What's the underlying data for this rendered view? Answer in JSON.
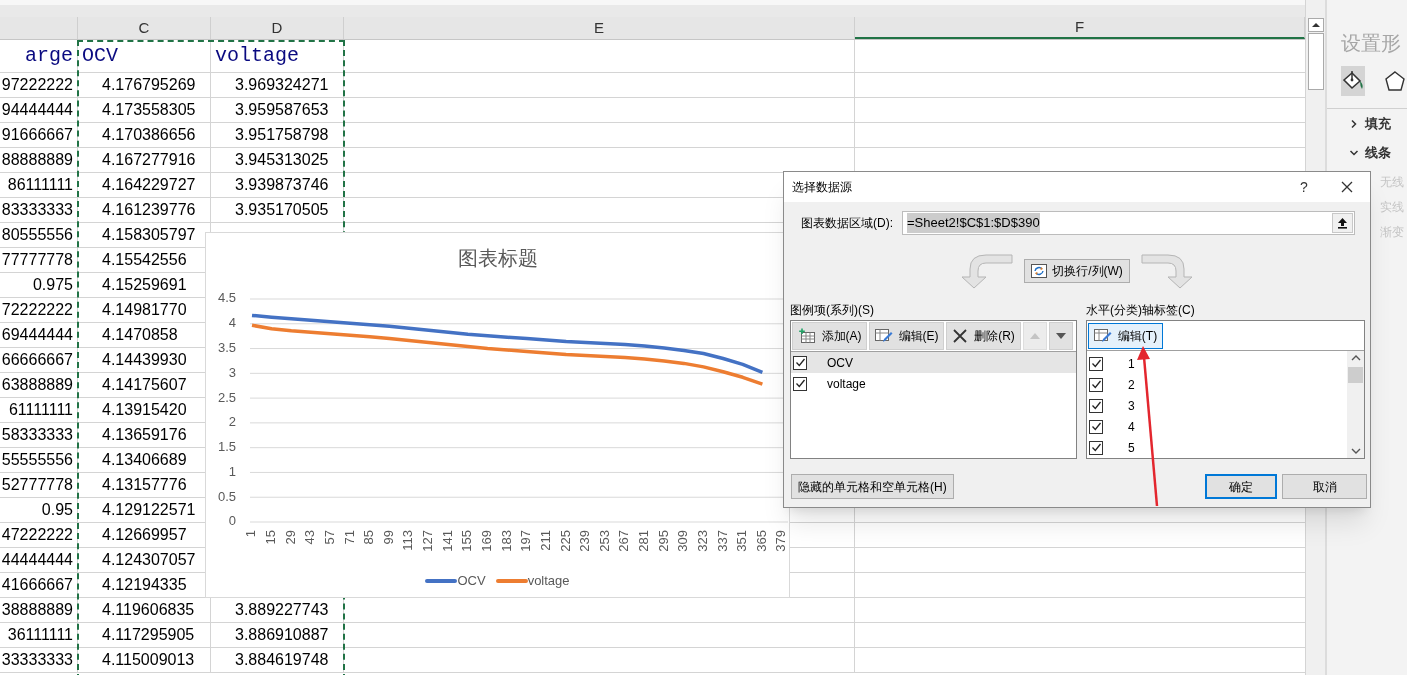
{
  "sheet": {
    "columns": [
      {
        "highlighted": false
      },
      {
        "label": "C",
        "highlighted": false
      },
      {
        "label": "D",
        "highlighted": false
      },
      {
        "label": "E",
        "highlighted": false
      },
      {
        "label": "F",
        "highlighted": true
      }
    ],
    "header_row": [
      "arge",
      "OCV",
      "voltage"
    ],
    "rows": [
      [
        "97222222",
        "4.176795269",
        "3.969324271"
      ],
      [
        "94444444",
        "4.173558305",
        "3.959587653"
      ],
      [
        "91666667",
        "4.170386656",
        "3.951758798"
      ],
      [
        "88888889",
        "4.167277916",
        "3.945313025"
      ],
      [
        "86111111",
        "4.164229727",
        "3.939873746"
      ],
      [
        "83333333",
        "4.161239776",
        "3.935170505"
      ],
      [
        "80555556",
        "4.158305797"
      ],
      [
        "77777778",
        "4.15542556"
      ],
      [
        "0.975",
        "4.15259691"
      ],
      [
        "72222222",
        "4.14981770"
      ],
      [
        "69444444",
        "4.1470858"
      ],
      [
        "66666667",
        "4.14439930"
      ],
      [
        "63888889",
        "4.14175607"
      ],
      [
        "61111111",
        "4.13915420"
      ],
      [
        "58333333",
        "4.13659176"
      ],
      [
        "55555556",
        "4.13406689"
      ],
      [
        "52777778",
        "4.13157776"
      ],
      [
        "0.95",
        "4.129122571"
      ],
      [
        "47222222",
        "4.12669957"
      ],
      [
        "44444444",
        "4.124307057"
      ],
      [
        "41666667",
        "4.12194335"
      ],
      [
        "38888889",
        "4.119606835",
        "3.889227743"
      ],
      [
        "36111111",
        "4.117295905",
        "3.886910887"
      ],
      [
        "33333333",
        "4.115009013",
        "3.884619748"
      ]
    ]
  },
  "chart": {
    "chart_data": {
      "type": "line",
      "title": "图表标题",
      "categories": [
        "1",
        "15",
        "29",
        "43",
        "57",
        "71",
        "85",
        "99",
        "113",
        "127",
        "141",
        "155",
        "169",
        "183",
        "197",
        "211",
        "225",
        "239",
        "253",
        "267",
        "281",
        "295",
        "309",
        "323",
        "337",
        "351",
        "365",
        "379"
      ],
      "series": [
        {
          "name": "OCV",
          "color": "#4472c4",
          "values": [
            4.17,
            4.13,
            4.1,
            4.07,
            4.04,
            4.01,
            3.98,
            3.95,
            3.91,
            3.87,
            3.83,
            3.79,
            3.76,
            3.73,
            3.7,
            3.67,
            3.64,
            3.62,
            3.6,
            3.58,
            3.55,
            3.51,
            3.46,
            3.4,
            3.3,
            3.18,
            3.02,
            null
          ]
        },
        {
          "name": "voltage",
          "color": "#ed7d31",
          "values": [
            3.97,
            3.9,
            3.86,
            3.83,
            3.8,
            3.77,
            3.74,
            3.7,
            3.66,
            3.62,
            3.58,
            3.54,
            3.5,
            3.47,
            3.44,
            3.41,
            3.38,
            3.36,
            3.34,
            3.32,
            3.29,
            3.25,
            3.2,
            3.13,
            3.03,
            2.92,
            2.78,
            null
          ]
        }
      ],
      "grid": true,
      "legend": true,
      "ylim": [
        0,
        4.5
      ],
      "yticks": [
        0,
        0.5,
        1,
        1.5,
        2,
        2.5,
        3,
        3.5,
        4,
        4.5
      ]
    }
  },
  "format_pane": {
    "title": "设置形",
    "tabs": [
      {
        "kind": "fill",
        "selected": true
      },
      {
        "kind": "shape",
        "selected": false
      }
    ],
    "sections": [
      {
        "label": "填充",
        "expanded": false
      },
      {
        "label": "线条",
        "expanded": true
      }
    ],
    "options": [
      "无线",
      "实线",
      "渐变"
    ]
  },
  "dialog": {
    "title": "选择数据源",
    "help": "?",
    "range_label": "图表数据区域(D):",
    "range_value": "=Sheet2!$C$1:$D$390",
    "switch_button": "切换行/列(W)",
    "series_panel": {
      "label": "图例项(系列)(S)",
      "buttons": [
        {
          "kind": "add",
          "label": "添加(A)"
        },
        {
          "kind": "edit",
          "label": "编辑(E)"
        },
        {
          "kind": "delete",
          "label": "删除(R)"
        },
        {
          "kind": "up",
          "disabled": true
        },
        {
          "kind": "down",
          "disabled": false
        }
      ],
      "items": [
        {
          "label": "OCV",
          "checked": true,
          "selected": true
        },
        {
          "label": "voltage",
          "checked": true,
          "selected": false
        }
      ]
    },
    "axis_panel": {
      "label": "水平(分类)轴标签(C)",
      "edit_button": {
        "label": "编辑(T)",
        "focused": true
      },
      "items": [
        {
          "label": "1",
          "checked": true
        },
        {
          "label": "2",
          "checked": true
        },
        {
          "label": "3",
          "checked": true
        },
        {
          "label": "4",
          "checked": true
        },
        {
          "label": "5",
          "checked": true
        }
      ]
    },
    "hidden_cells_button": "隐藏的单元格和空单元格(H)",
    "ok_button": "确定",
    "cancel_button": "取消"
  }
}
